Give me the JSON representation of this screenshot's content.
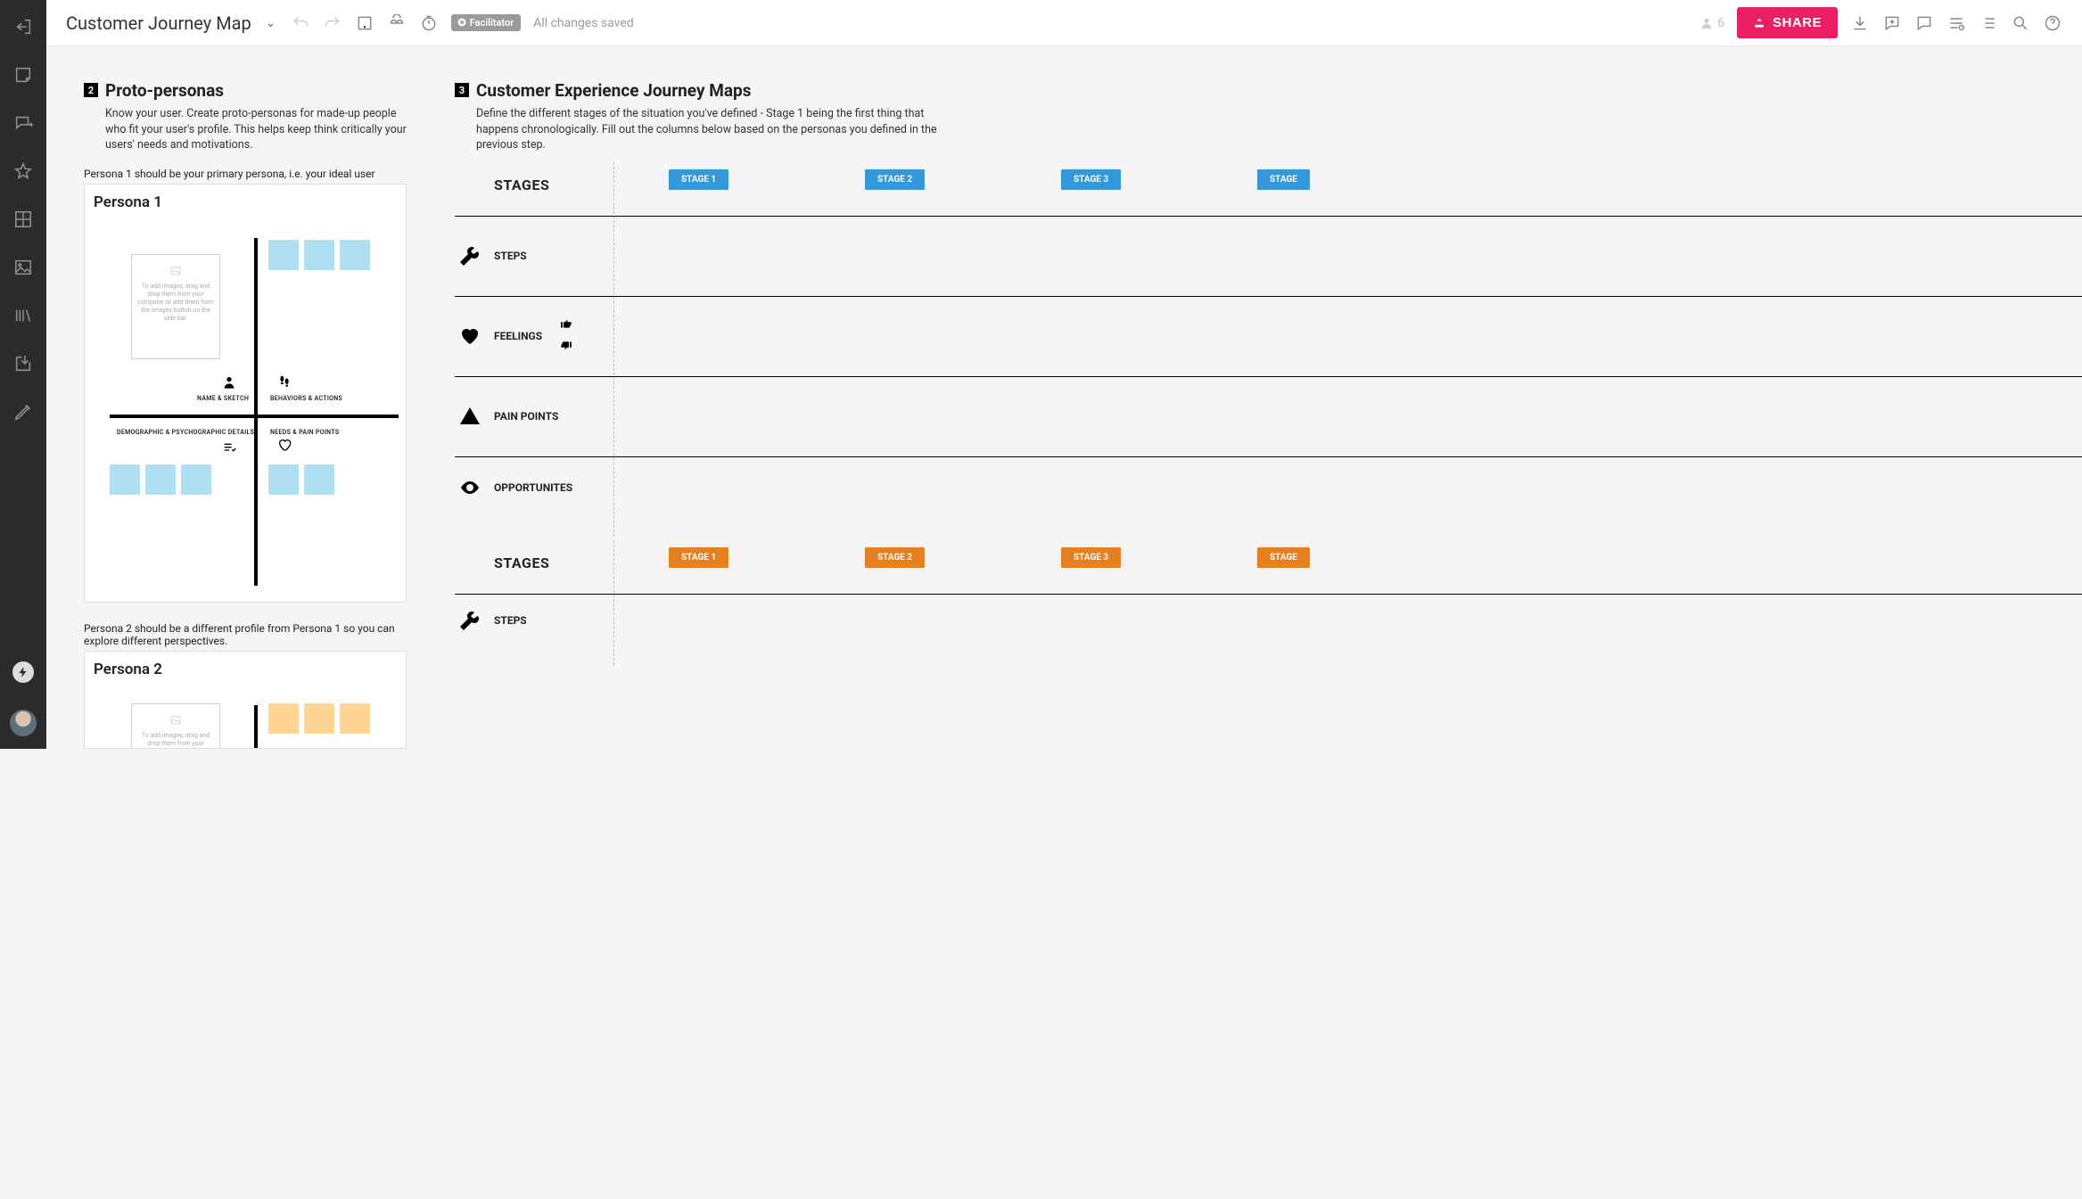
{
  "header": {
    "doc_title": "Customer Journey Map",
    "facilitator_badge": "Facilitator",
    "saved_status": "All changes saved",
    "participants_count": "6",
    "share_label": "SHARE"
  },
  "sections": {
    "personas": {
      "number": "2",
      "title": "Proto-personas",
      "description": "Know your user. Create proto-personas for made-up people who fit your user's profile. This helps keep think critically your users' needs and motivations.",
      "notes": {
        "p1": "Persona 1 should be your primary persona, i.e. your ideal user",
        "p2": "Persona 2 should be a different profile from Persona 1 so you can explore different perspectives."
      },
      "cards": {
        "p1_title": "Persona 1",
        "p2_title": "Persona 2"
      },
      "quad_labels": {
        "tl": "NAME & SKETCH",
        "tr": "BEHAVIORS & ACTIONS",
        "bl": "DEMOGRAPHIC & PSYCHOGRAPHIC DETAILS",
        "br": "NEEDS & PAIN POINTS"
      },
      "image_placeholder": "To add images, drag and drop them from your computer or add them from the Images button on the side bar."
    },
    "maps": {
      "number": "3",
      "title": "Customer Experience Journey Maps",
      "description": "Define the different stages of the situation you've defined - Stage 1 being the first thing that happens chronologically.  Fill out the columns below based on the personas you defined in the previous step.",
      "stages_label": "STAGES",
      "stage_chips": [
        "STAGE 1",
        "STAGE 2",
        "STAGE 3",
        "STAGE"
      ],
      "lanes": {
        "steps": "STEPS",
        "feelings": "FEELINGS",
        "pain": "PAIN POINTS",
        "opp": "OPPORTUNITES"
      }
    }
  },
  "colors": {
    "accent_pink": "#e91e63",
    "chip_blue": "#3498db",
    "chip_orange": "#e67e22",
    "sticky_blue": "#aee0f2",
    "sticky_yellow": "#ffd591"
  }
}
